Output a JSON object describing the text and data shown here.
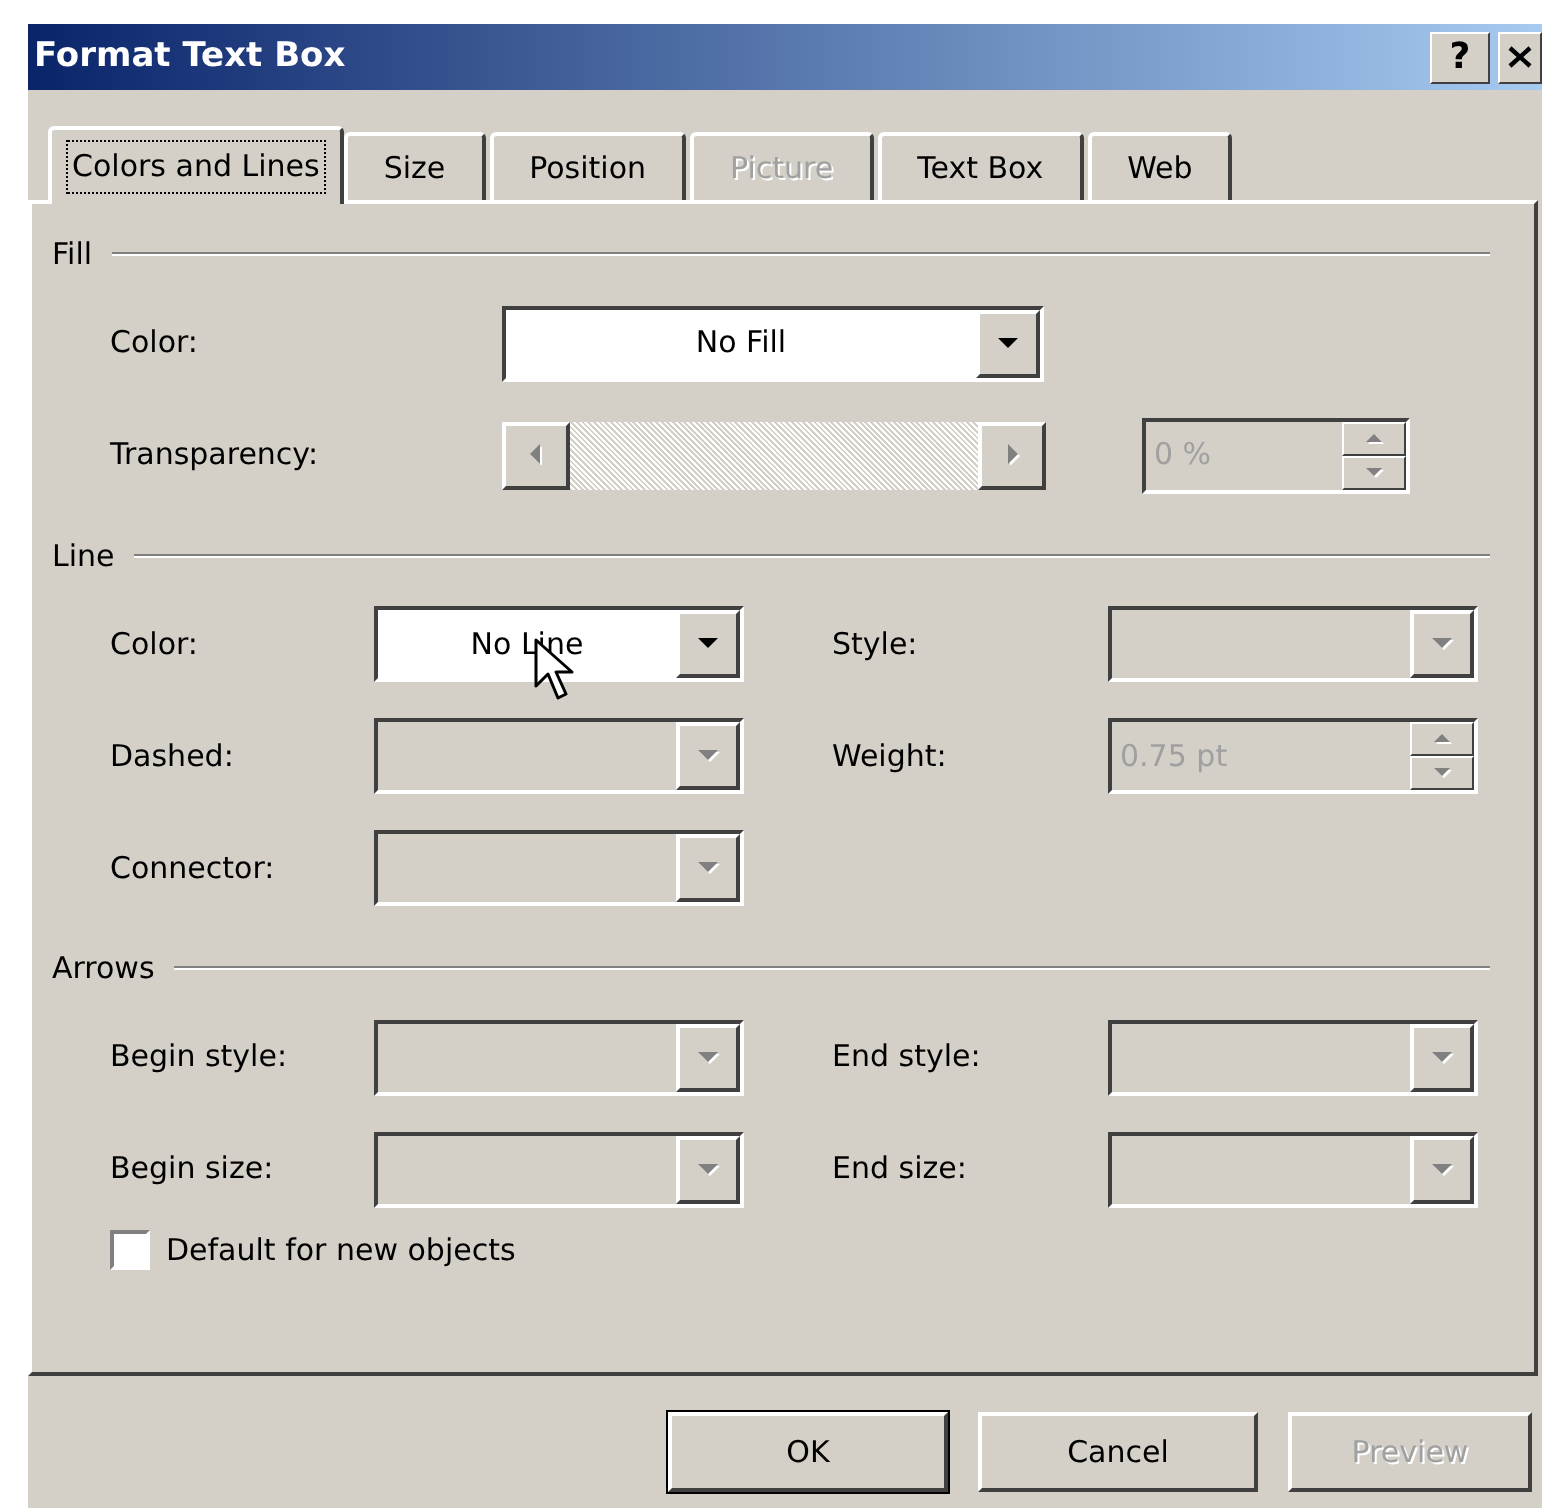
{
  "window": {
    "title": "Format Text Box",
    "help_label": "?"
  },
  "tabs": [
    {
      "label": "Colors and Lines",
      "selected": true,
      "disabled": false
    },
    {
      "label": "Size",
      "selected": false,
      "disabled": false
    },
    {
      "label": "Position",
      "selected": false,
      "disabled": false
    },
    {
      "label": "Picture",
      "selected": false,
      "disabled": true
    },
    {
      "label": "Text Box",
      "selected": false,
      "disabled": false
    },
    {
      "label": "Web",
      "selected": false,
      "disabled": false
    }
  ],
  "sections": [
    {
      "title": "Fill",
      "wide": true,
      "rows": [
        [
          {
            "label": "Color:",
            "kind": "combo",
            "value": "No Fill",
            "disabled": false
          }
        ],
        [
          {
            "label": "Transparency:",
            "kind": "scrollbar",
            "disabled": true
          },
          {
            "kind": "spin",
            "value": "0 %",
            "disabled": true
          }
        ]
      ]
    },
    {
      "title": "Line",
      "wide": false,
      "rows": [
        [
          {
            "label": "Color:",
            "kind": "combo",
            "value": "No Line",
            "disabled": false,
            "hovered": true
          },
          {
            "label": "Style:",
            "kind": "combo",
            "disabled": true
          }
        ],
        [
          {
            "label": "Dashed:",
            "kind": "combo",
            "disabled": true
          },
          {
            "label": "Weight:",
            "kind": "spin",
            "value": "0.75 pt",
            "disabled": true
          }
        ],
        [
          {
            "label": "Connector:",
            "kind": "combo",
            "disabled": true
          }
        ]
      ]
    },
    {
      "title": "Arrows",
      "wide": false,
      "rows": [
        [
          {
            "label": "Begin style:",
            "kind": "combo",
            "disabled": true
          },
          {
            "label": "End style:",
            "kind": "combo",
            "disabled": true
          }
        ],
        [
          {
            "label": "Begin size:",
            "kind": "combo",
            "disabled": true
          },
          {
            "label": "End size:",
            "kind": "combo",
            "disabled": true
          }
        ]
      ]
    }
  ],
  "checkbox": {
    "label": "Default for new objects",
    "checked": false
  },
  "buttons": [
    {
      "label": "OK",
      "default": true,
      "disabled": false
    },
    {
      "label": "Cancel",
      "default": false,
      "disabled": false
    },
    {
      "label": "Preview",
      "default": false,
      "disabled": true
    }
  ]
}
